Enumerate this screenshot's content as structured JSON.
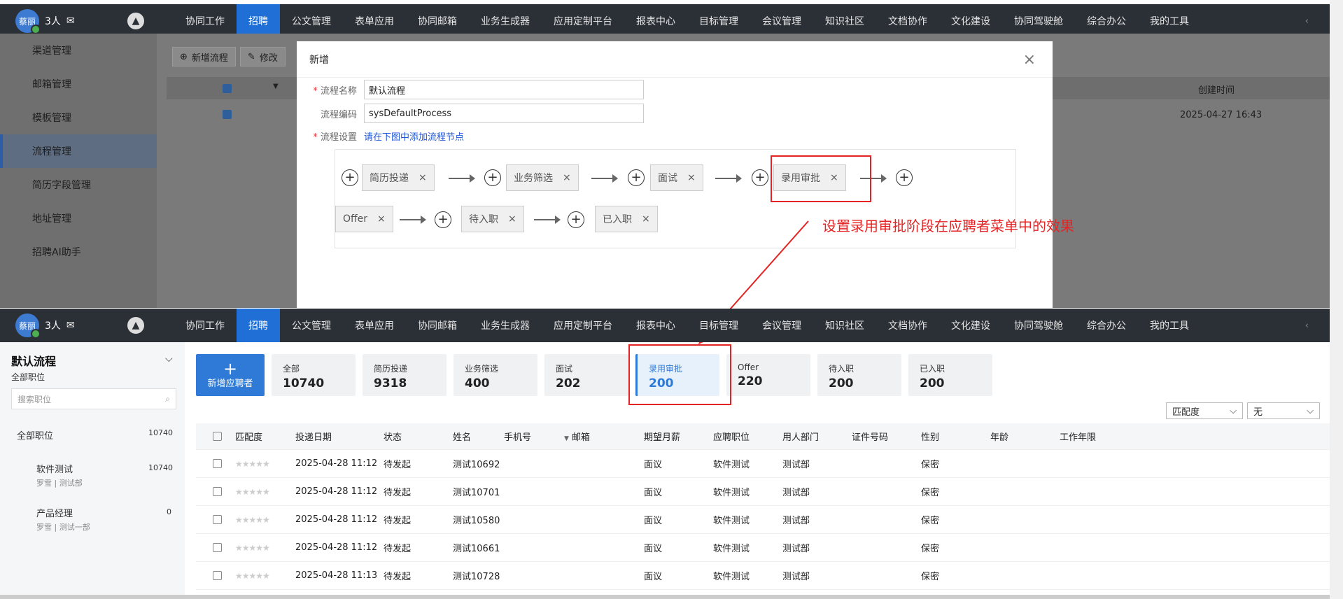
{
  "user": {
    "avatar_text": "蔡丽",
    "count": "3人"
  },
  "nav": [
    "协同工作",
    "招聘",
    "公文管理",
    "表单应用",
    "协同邮箱",
    "业务生成器",
    "应用定制平台",
    "报表中心",
    "目标管理",
    "会议管理",
    "知识社区",
    "文档协作",
    "文化建设",
    "协同驾驶舱",
    "综合办公",
    "我的工具"
  ],
  "nav_active": "招聘",
  "old_sidebar": [
    "渠道管理",
    "邮箱管理",
    "模板管理",
    "流程管理",
    "简历字段管理",
    "地址管理",
    "招聘AI助手"
  ],
  "old_toolbar": {
    "add": "新增流程",
    "edit": "修改"
  },
  "old_table": {
    "col_created": "创建时间",
    "row_created": "2025-04-27 16:43"
  },
  "modal": {
    "title": "新增",
    "name_label": "流程名称",
    "name_value": "默认流程",
    "code_label": "流程编码",
    "code_value": "sysDefaultProcess",
    "setting_label": "流程设置",
    "setting_hint": "请在下图中添加流程节点",
    "nodes_row1": [
      "简历投递",
      "业务筛选",
      "面试",
      "录用审批"
    ],
    "nodes_row2": [
      "Offer",
      "待入职",
      "已入职"
    ]
  },
  "annotation": "设置录用审批阶段在应聘者菜单中的效果",
  "lower": {
    "process_title": "默认流程",
    "process_sub": "全部职位",
    "search_placeholder": "搜索职位",
    "positions": [
      {
        "name": "全部职位",
        "count": "10740",
        "sub": ""
      },
      {
        "name": "软件测试",
        "count": "10740",
        "sub": "罗雪 | 测试部"
      },
      {
        "name": "产品经理",
        "count": "0",
        "sub": "罗雪 | 测试一部"
      }
    ],
    "add_label": "新增应聘者",
    "stages": [
      {
        "name": "全部",
        "value": "10740"
      },
      {
        "name": "简历投递",
        "value": "9318"
      },
      {
        "name": "业务筛选",
        "value": "400"
      },
      {
        "name": "面试",
        "value": "202"
      },
      {
        "name": "录用审批",
        "value": "200"
      },
      {
        "name": "Offer",
        "value": "220"
      },
      {
        "name": "待入职",
        "value": "200"
      },
      {
        "name": "已入职",
        "value": "200"
      }
    ],
    "sort_select": "匹配度",
    "filter_select": "无",
    "columns": [
      "匹配度",
      "投递日期",
      "状态",
      "姓名",
      "手机号",
      "邮箱",
      "期望月薪",
      "应聘职位",
      "用人部门",
      "证件号码",
      "性别",
      "年龄",
      "工作年限"
    ],
    "rows": [
      {
        "date": "2025-04-28 11:12",
        "status": "待发起",
        "name": "测试10692",
        "salary": "面议",
        "position": "软件测试",
        "dept": "测试部",
        "gender": "保密"
      },
      {
        "date": "2025-04-28 11:12",
        "status": "待发起",
        "name": "测试10701",
        "salary": "面议",
        "position": "软件测试",
        "dept": "测试部",
        "gender": "保密"
      },
      {
        "date": "2025-04-28 11:12",
        "status": "待发起",
        "name": "测试10580",
        "salary": "面议",
        "position": "软件测试",
        "dept": "测试部",
        "gender": "保密"
      },
      {
        "date": "2025-04-28 11:12",
        "status": "待发起",
        "name": "测试10661",
        "salary": "面议",
        "position": "软件测试",
        "dept": "测试部",
        "gender": "保密"
      },
      {
        "date": "2025-04-28 11:13",
        "status": "待发起",
        "name": "测试10728",
        "salary": "面议",
        "position": "软件测试",
        "dept": "测试部",
        "gender": "保密"
      }
    ]
  },
  "colors": {
    "accent": "#2e7ad6",
    "annotation": "#e42424",
    "topbar": "#2b2f36"
  }
}
